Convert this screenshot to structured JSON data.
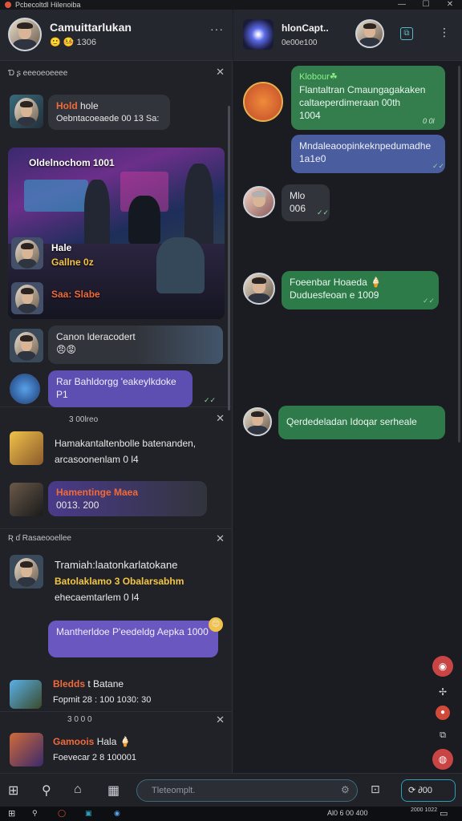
{
  "window": {
    "title": "Pcbecoltdl Hilenoiba",
    "buttons": [
      "—",
      "☐",
      "✕"
    ]
  },
  "left_header": {
    "name": "Camuittarlukan",
    "status": "🙂 🤒 1306",
    "menu": "···"
  },
  "section1": {
    "title": "Ɗ ʂ  eeeoeoeeee",
    "close": "✕"
  },
  "msg1": {
    "name": "Hold",
    "rest": " hole",
    "text": "Oebntacoeaede 00 13 Sa:"
  },
  "media": {
    "caption": "Oldelnochom 1001",
    "row1_name": "Hale",
    "row1_sub": "Gallne 0z",
    "row2_name": "Saa: Slabe"
  },
  "msg2": {
    "text": "Canon lderacodert",
    "emoji": "😠😡"
  },
  "msg3": {
    "text": "Rar Bahldorgg 'eakeylkdoke P1",
    "tick": "✓✓"
  },
  "section2": {
    "title": "3  00lreo",
    "close": "✕"
  },
  "msg4": {
    "line1": "Hamakantaltenbolle batenanden,",
    "line2": "arcasoonenlam 0 l4"
  },
  "msg5": {
    "name": "Hamentinge Maea",
    "sub": "0013. 200"
  },
  "section3": {
    "title": "Ʀ  ɗ  Rasaeooellee",
    "close": "✕"
  },
  "msg6": {
    "line1": "Tramiah:laatonkarlatokane",
    "line2": "Batolaklamo 3 Obalarsabhm",
    "line3": "ehecaemtarlem 0 l4"
  },
  "msg7": {
    "text": "Mantherldoe P'eedeldg Aepka 1000"
  },
  "msg8": {
    "name": "Bledds",
    "rest": " t Batane",
    "sub": "Fopmit 28 : 100 1030: 30"
  },
  "section4": {
    "title": "3 0 0   0",
    "close": "✕"
  },
  "msg9": {
    "name": "Gamoois",
    "rest": " Hala 🍦",
    "sub": "Foevecar 2 8 100001"
  },
  "right_header": {
    "name": "hlonCapt..",
    "sub": "0e00e100",
    "menu": "⋮",
    "icon_btn": "⧉"
  },
  "rmsg1": {
    "name": "Klobour☘",
    "line1": "Flantaltran Cmaungagakaken",
    "line2": "caltaeperdimeraan 00th",
    "line3": "1004",
    "time": "0 0l"
  },
  "rmsg2": {
    "text": "Mndaleaoopinkeknpedumadhe",
    "sub": "1a1e0",
    "tick": "✓✓"
  },
  "rmsg3": {
    "text": "Mlo",
    "sub": "006",
    "tick": "✓✓"
  },
  "rmsg4": {
    "line1": "Foeenbar Hoaeda 🍦",
    "line2": "Duduesfeoan e 1009",
    "tick": "✓✓"
  },
  "rmsg5": {
    "text": "Qerdedeladan Idoqar serheale"
  },
  "composer": {
    "placeholder": "Tleteomplt.",
    "send": "⟳  ∂00"
  },
  "taskbar": {
    "time": "Al0 6  00 400",
    "date": "2000 1022"
  }
}
